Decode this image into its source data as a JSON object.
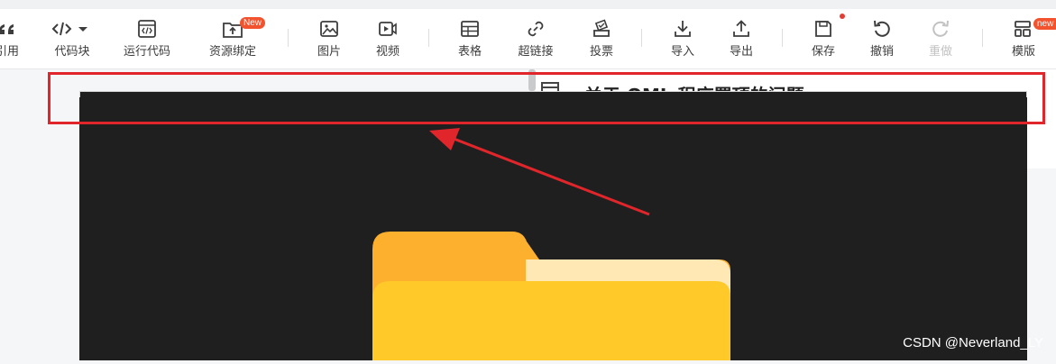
{
  "toolbar": {
    "items": [
      {
        "label": "引用",
        "icon": "quote-icon"
      },
      {
        "label": "代码块",
        "icon": "code-block-icon"
      },
      {
        "label": "运行代码",
        "icon": "run-code-icon"
      },
      {
        "label": "资源绑定",
        "icon": "resource-bind-icon",
        "badge": "New"
      },
      {
        "label": "图片",
        "icon": "image-icon"
      },
      {
        "label": "视频",
        "icon": "video-icon"
      },
      {
        "label": "表格",
        "icon": "table-icon"
      },
      {
        "label": "超链接",
        "icon": "link-icon"
      },
      {
        "label": "投票",
        "icon": "vote-icon"
      },
      {
        "label": "导入",
        "icon": "import-icon"
      },
      {
        "label": "导出",
        "icon": "export-icon"
      },
      {
        "label": "保存",
        "icon": "save-icon"
      },
      {
        "label": "撤销",
        "icon": "undo-icon"
      },
      {
        "label": "重做",
        "icon": "redo-icon",
        "disabled": true
      },
      {
        "label": "模版",
        "icon": "template-icon",
        "badge": "new"
      }
    ]
  },
  "document": {
    "peek_title": "关于 QML 程序置顶的问题"
  },
  "watermark": "CSDN @Neverland_LY",
  "colors": {
    "annotation": "#e0262b",
    "dark_panel": "#1f1f1f",
    "folder_back": "#fdb02d",
    "folder_front": "#ffc929",
    "folder_paper": "#ffe8b3",
    "badge": "#f2522e"
  }
}
